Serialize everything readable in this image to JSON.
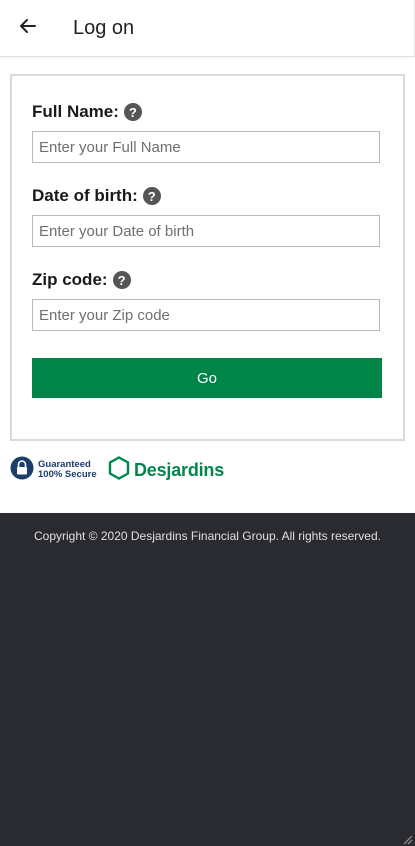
{
  "header": {
    "title": "Log on",
    "back_icon": "arrow-left-icon"
  },
  "form": {
    "full_name": {
      "label": "Full Name:",
      "placeholder": "Enter your Full Name",
      "value": ""
    },
    "date_of_birth": {
      "label": "Date of birth:",
      "placeholder": "Enter your Date of birth",
      "value": ""
    },
    "zip_code": {
      "label": "Zip code:",
      "placeholder": "Enter your Zip code",
      "value": ""
    },
    "help_glyph": "?",
    "submit_label": "Go"
  },
  "badges": {
    "secure_line1": "Guaranteed",
    "secure_line2": "100% Secure",
    "brand_name": "Desjardins"
  },
  "footer": {
    "copyright": "Copyright © 2020 Desjardins Financial Group. All rights reserved."
  },
  "colors": {
    "brand_green": "#008448",
    "footer_bg": "#2a2b30",
    "secure_blue": "#1d3d6b"
  }
}
